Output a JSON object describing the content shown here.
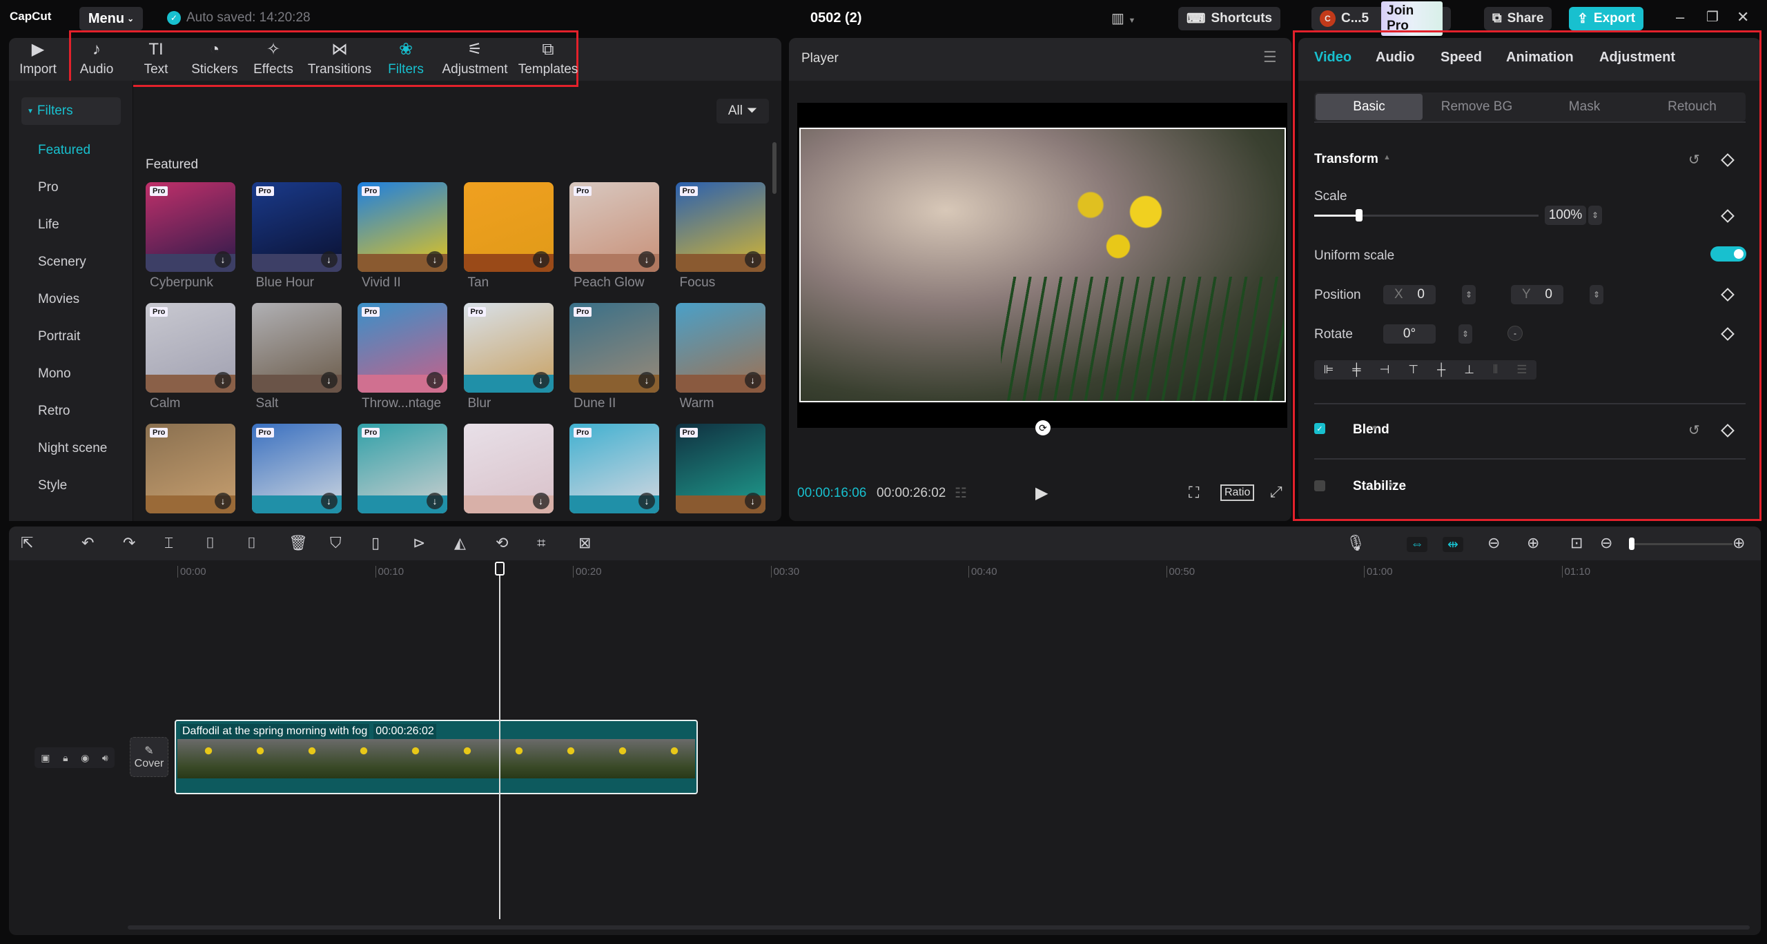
{
  "app": {
    "logo": "CapCut",
    "menu_label": "Menu",
    "autosave": "Auto saved: 14:20:28",
    "project_title": "0502 (2)"
  },
  "topbar": {
    "shortcuts": "Shortcuts",
    "user": "C...5",
    "user_initial": "C",
    "join_pro": "Join Pro",
    "share": "Share",
    "export": "Export"
  },
  "toolbar": [
    {
      "label": "Import",
      "icon": "▶"
    },
    {
      "label": "Audio",
      "icon": "♪"
    },
    {
      "label": "Text",
      "icon": "TI"
    },
    {
      "label": "Stickers",
      "icon": "◔"
    },
    {
      "label": "Effects",
      "icon": "✧"
    },
    {
      "label": "Transitions",
      "icon": "⋈"
    },
    {
      "label": "Filters",
      "icon": "❀"
    },
    {
      "label": "Adjustment",
      "icon": "⚟"
    },
    {
      "label": "Templates",
      "icon": "⧉"
    }
  ],
  "sidebar": {
    "header": "Filters",
    "items": [
      "Featured",
      "Pro",
      "Life",
      "Scenery",
      "Movies",
      "Portrait",
      "Mono",
      "Retro",
      "Night scene",
      "Style"
    ]
  },
  "filters": {
    "all_label": "All",
    "section": "Featured",
    "items": [
      {
        "name": "Cyberpunk",
        "pro": true,
        "top": "#c0306a",
        "bg": "#2a1a4a",
        "strip": "#3d3f66"
      },
      {
        "name": "Blue Hour",
        "pro": true,
        "top": "#1a3a8a",
        "bg": "#0a1030",
        "strip": "#3d3f66"
      },
      {
        "name": "Vivid II",
        "pro": true,
        "top": "#1d7fe0",
        "bg": "#e8c61a",
        "strip": "#8a5a30"
      },
      {
        "name": "Tan",
        "pro": false,
        "top": "#f0a020",
        "bg": "#e09a18",
        "strip": "#9a4a18"
      },
      {
        "name": "Peach Glow",
        "pro": true,
        "top": "#d8c8c0",
        "bg": "#c89078",
        "strip": "#b07860"
      },
      {
        "name": "Focus",
        "pro": true,
        "top": "#2a60b0",
        "bg": "#d8b830",
        "strip": "#8a5a30"
      },
      {
        "name": "Calm",
        "pro": true,
        "top": "#c8c8d0",
        "bg": "#a0a0b0",
        "strip": "#8a6048"
      },
      {
        "name": "Salt",
        "pro": false,
        "top": "#b0b0b4",
        "bg": "#6a5a48",
        "strip": "#6a5448"
      },
      {
        "name": "Throw...ntage",
        "pro": true,
        "top": "#3a90c8",
        "bg": "#c86088",
        "strip": "#d07090"
      },
      {
        "name": "Blur",
        "pro": true,
        "top": "#d8e0e8",
        "bg": "#c8a060",
        "strip": "#2090a8"
      },
      {
        "name": "Dune II",
        "pro": true,
        "top": "#3a7088",
        "bg": "#9a8a78",
        "strip": "#8a6030"
      },
      {
        "name": "Warm",
        "pro": false,
        "top": "#4aa0c8",
        "bg": "#a07050",
        "strip": "#8a5a40"
      },
      {
        "name": "",
        "pro": true,
        "top": "#8a7050",
        "bg": "#c8a070",
        "strip": "#9a6a38"
      },
      {
        "name": "",
        "pro": true,
        "top": "#3a70c0",
        "bg": "#d0d8e0",
        "strip": "#2090a8"
      },
      {
        "name": "",
        "pro": true,
        "top": "#30a0a8",
        "bg": "#d0d0d0",
        "strip": "#2090a8"
      },
      {
        "name": "",
        "pro": false,
        "top": "#e8e0e8",
        "bg": "#d8c0c8",
        "strip": "#d8b0a8"
      },
      {
        "name": "",
        "pro": true,
        "top": "#40b0d0",
        "bg": "#d8d8e0",
        "strip": "#2090a8"
      },
      {
        "name": "",
        "pro": true,
        "top": "#103040",
        "bg": "#20a090",
        "strip": "#8a5a30"
      }
    ]
  },
  "player": {
    "title": "Player",
    "current_time": "00:00:16:06",
    "total_time": "00:00:26:02",
    "ratio": "Ratio"
  },
  "inspector": {
    "tabs": [
      "Video",
      "Audio",
      "Speed",
      "Animation",
      "Adjustment"
    ],
    "subtabs": [
      "Basic",
      "Remove BG",
      "Mask",
      "Retouch"
    ],
    "transform": "Transform",
    "scale_label": "Scale",
    "scale_value": "100%",
    "scale_fraction": 0.2,
    "uniform_scale": "Uniform scale",
    "uniform_on": true,
    "position_label": "Position",
    "x_label": "X",
    "x_value": "0",
    "y_label": "Y",
    "y_value": "0",
    "rotate_label": "Rotate",
    "rotate_value": "0°",
    "blend": "Blend",
    "blend_checked": true,
    "stabilize": "Stabilize",
    "stabilize_checked": false
  },
  "timeline": {
    "ticks": [
      "00:00",
      "00:10",
      "00:20",
      "00:30",
      "00:40",
      "00:50",
      "01:00",
      "01:10"
    ],
    "clip_title": "Daffodil at the spring morning with fog",
    "clip_duration": "00:00:26:02",
    "cover": "Cover",
    "playhead_seconds": 16.2
  },
  "colors": {
    "accent": "#18c0cf",
    "clip": "#0d5a5e",
    "redbox": "#e3212b"
  }
}
